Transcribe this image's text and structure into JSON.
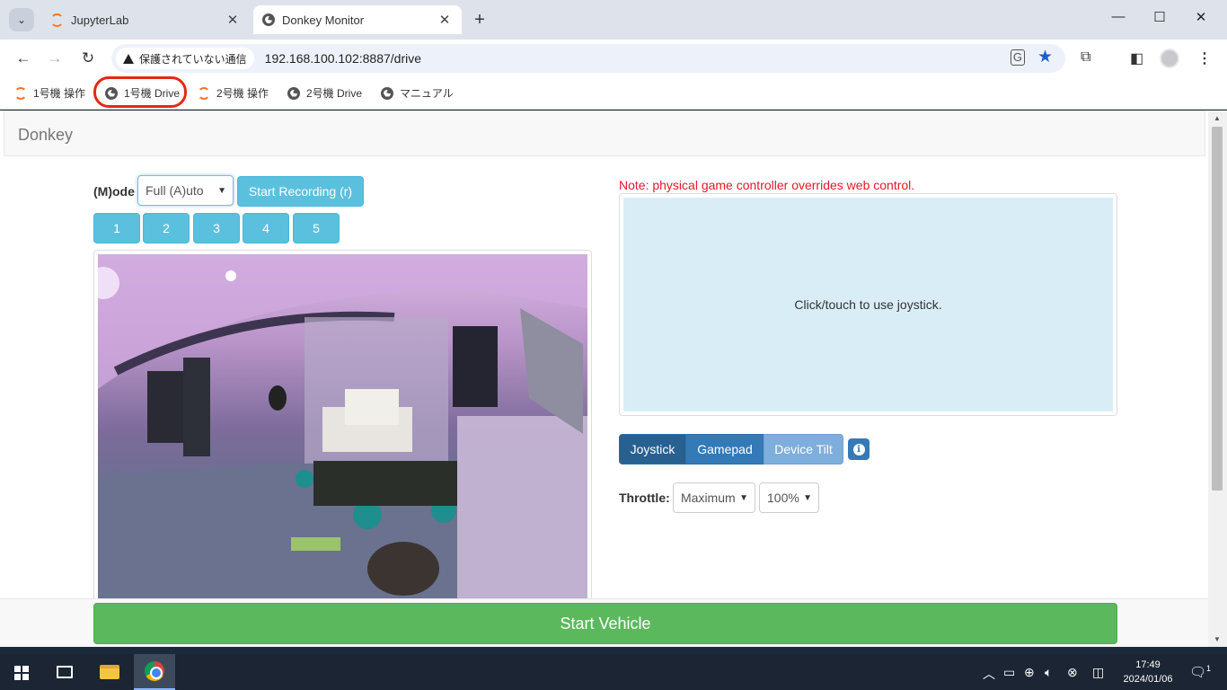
{
  "browser": {
    "tabs": [
      {
        "title": "JupyterLab",
        "active": false
      },
      {
        "title": "Donkey Monitor",
        "active": true
      }
    ],
    "new_tab_symbol": "+",
    "window_controls": {
      "minimize": "—",
      "maximize": "☐",
      "close": "✕"
    },
    "url": "192.168.100.102:8887/drive",
    "security_text": "保護されていない通信",
    "bookmarks": [
      {
        "label": "1号機 操作",
        "icon": "jupyter-icon"
      },
      {
        "label": "1号機 Drive",
        "icon": "globe-icon"
      },
      {
        "label": "2号機 操作",
        "icon": "jupyter-icon"
      },
      {
        "label": "2号機 Drive",
        "icon": "globe-icon"
      },
      {
        "label": "マニュアル",
        "icon": "globe-icon"
      }
    ],
    "highlight_color": "#e32a12"
  },
  "page": {
    "brand": "Donkey",
    "mode_label": "(M)ode",
    "mode_value": "Full (A)uto",
    "record_button": "Start Recording (r)",
    "number_buttons": [
      "1",
      "2",
      "3",
      "4",
      "5"
    ],
    "note": "Note: physical game controller overrides web control.",
    "joystick_hint": "Click/touch to use joystick.",
    "control_modes": [
      "Joystick",
      "Gamepad",
      "Device Tilt"
    ],
    "active_control_mode": "Joystick",
    "throttle_label": "Throttle:",
    "throttle_mode": "Maximum",
    "throttle_value": "100%",
    "start_button": "Start Vehicle",
    "colors": {
      "info": "#5bc0de",
      "primary": "#337ab7",
      "success": "#5cb85c",
      "danger_text": "#e4182b",
      "joystick_bg": "#d9edf7"
    }
  },
  "taskbar": {
    "time": "17:49",
    "date": "2024/01/06",
    "notification_count": "1"
  }
}
